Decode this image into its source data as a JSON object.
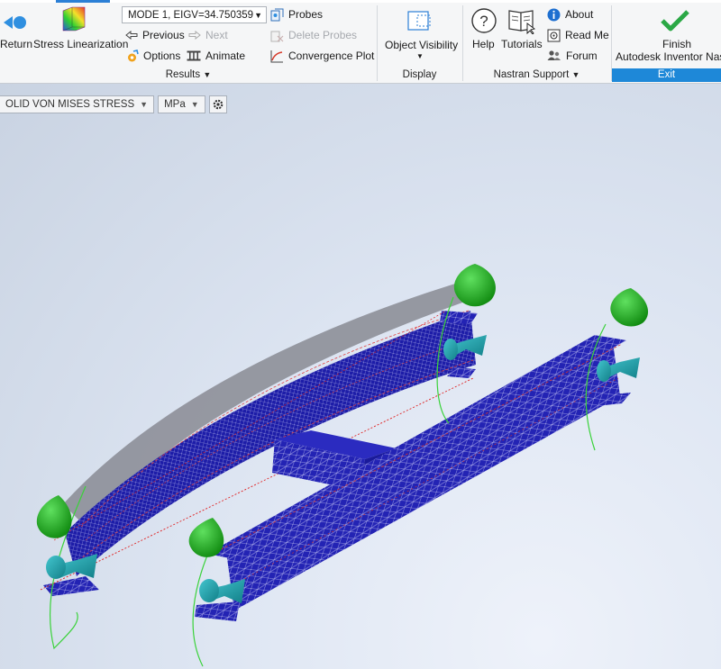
{
  "ribbon": {
    "results": {
      "return_label": "Return",
      "stress_linearization_label": "Stress Linearization",
      "mode_select_value": "MODE 1, EIGV=34.750359",
      "previous_label": "Previous",
      "next_label": "Next",
      "options_label": "Options",
      "animate_label": "Animate",
      "probes_label": "Probes",
      "delete_probes_label": "Delete Probes",
      "convergence_plot_label": "Convergence Plot",
      "group_label": "Results"
    },
    "display": {
      "object_visibility_label": "Object Visibility",
      "group_label": "Display"
    },
    "support": {
      "help_label": "Help",
      "tutorials_label": "Tutorials",
      "about_label": "About",
      "read_me_label": "Read Me",
      "forum_label": "Forum",
      "group_label": "Nastran Support"
    },
    "exit": {
      "finish_label": "Finish",
      "finish_sublabel": "Autodesk Inventor Nast",
      "group_label": "Exit"
    }
  },
  "viewport": {
    "result_type": "OLID VON MISES STRESS",
    "unit": "MPa"
  },
  "colors": {
    "accent": "#1e88d8",
    "mesh_blue": "#2323b4",
    "constraint_green": "#22b422",
    "load_cyan": "#1aa0a8",
    "finish_green": "#2aa845"
  }
}
